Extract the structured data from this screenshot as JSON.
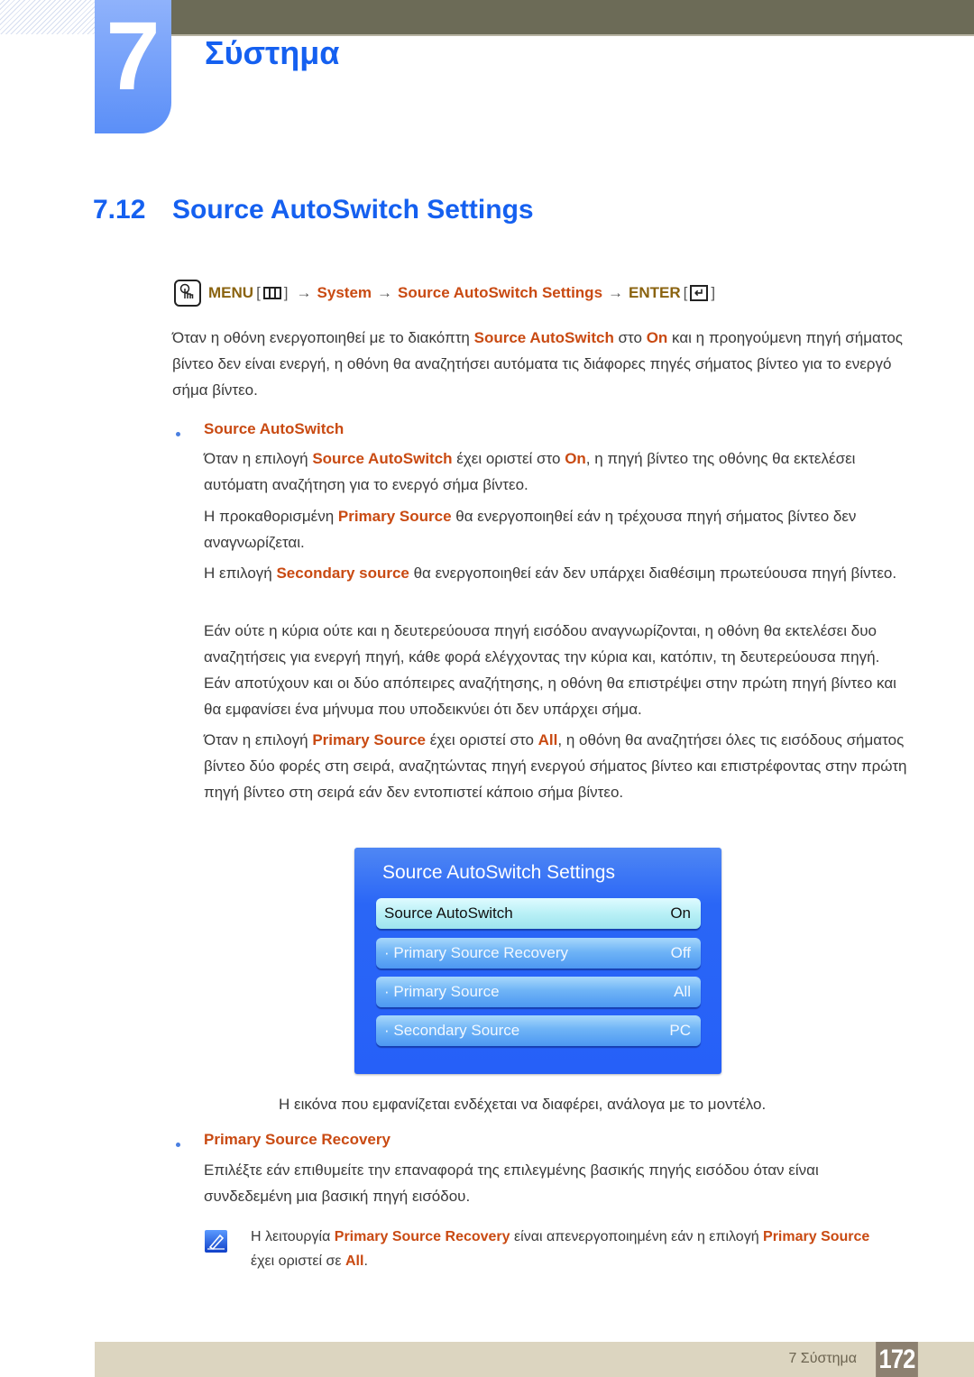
{
  "header": {
    "chapter_number": "7",
    "chapter_title": "Σύστημα"
  },
  "section": {
    "number": "7.12",
    "title": "Source AutoSwitch Settings"
  },
  "menu_path": {
    "icon": "hand-pointer-icon",
    "menu_label": "MENU",
    "menu_icon": "menu-grid-icon",
    "arrow": "→",
    "system_label": "System",
    "page_label": "Source AutoSwitch Settings",
    "enter_label": "ENTER",
    "enter_icon": "enter-return-icon",
    "open_bracket": "[",
    "close_bracket": "]"
  },
  "intro": {
    "p1": "Όταν η οθόνη ενεργοποιηθεί με το διακόπτη ",
    "k1": "Source AutoSwitch",
    "p2": " στο ",
    "k2": "On",
    "p3": " και η προηγούμενη πηγή σήματος βίντεο δεν είναι ενεργή, η οθόνη θα αναζητήσει αυτόματα τις διάφορες πηγές σήματος βίντεο για το ενεργό σήμα βίντεο."
  },
  "bullets": [
    {
      "heading": "Source AutoSwitch",
      "paragraphs": {
        "a": {
          "t1": "Όταν η επιλογή ",
          "k1": "Source AutoSwitch",
          "t2": " έχει οριστεί στο ",
          "k2": "On",
          "t3": ", η πηγή βίντεο της οθόνης θα εκτελέσει αυτόματη αναζήτηση για το ενεργό σήμα βίντεο."
        },
        "b": {
          "t1": "Η προκαθορισμένη ",
          "k1": "Primary Source",
          "t2": " θα ενεργοποιηθεί εάν η τρέχουσα πηγή σήματος βίντεο δεν αναγνωρίζεται."
        },
        "c": {
          "t1": "Η επιλογή ",
          "k1": "Secondary source",
          "t2": " θα ενεργοποιηθεί εάν δεν υπάρχει διαθέσιμη πρωτεύουσα πηγή βίντεο."
        },
        "d": {
          "t1": "Εάν ούτε η κύρια ούτε και η δευτερεύουσα πηγή εισόδου αναγνωρίζονται, η οθόνη θα εκτελέσει δυο αναζητήσεις για ενεργή πηγή, κάθε φορά ελέγχοντας την κύρια και, κατόπιν, τη δευτερεύουσα πηγή. Εάν αποτύχουν και οι δύο απόπειρες αναζήτησης, η οθόνη θα επιστρέψει στην πρώτη πηγή βίντεο και θα εμφανίσει ένα μήνυμα που υποδεικνύει ότι δεν υπάρχει σήμα."
        },
        "e": {
          "t1": "Όταν η επιλογή ",
          "k1": "Primary Source",
          "t2": " έχει οριστεί στο ",
          "k2": "All",
          "t3": ", η οθόνη θα αναζητήσει όλες τις εισόδους σήματος βίντεο δύο φορές στη σειρά, αναζητώντας πηγή ενεργού σήματος βίντεο και επιστρέφοντας στην πρώτη πηγή βίντεο στη σειρά εάν δεν εντοπιστεί κάποιο σήμα βίντεο."
        }
      }
    },
    {
      "heading": "Primary Source Recovery",
      "paragraphs": {
        "a": {
          "t1": "Επιλέξτε εάν επιθυμείτε την επαναφορά της επιλεγμένης βασικής πηγής εισόδου όταν είναι συνδεδεμένη μια βασική πηγή εισόδου."
        }
      }
    }
  ],
  "osd": {
    "title": "Source AutoSwitch Settings",
    "rows": [
      {
        "label": "Source AutoSwitch",
        "value": "On",
        "selected": true
      },
      {
        "label": "· Primary Source Recovery",
        "value": "Off",
        "selected": false
      },
      {
        "label": "· Primary Source",
        "value": "All",
        "selected": false
      },
      {
        "label": "· Secondary Source",
        "value": "PC",
        "selected": false
      }
    ]
  },
  "caption": "Η εικόνα που εμφανίζεται ενδέχεται να διαφέρει, ανάλογα με το μοντέλο.",
  "note": {
    "icon": "note-pencil-icon",
    "t1": "Η λειτουργία ",
    "k1": "Primary Source Recovery",
    "t2": " είναι απενεργοποιημένη εάν η επιλογή ",
    "k2": "Primary Source",
    "t3": " έχει οριστεί σε ",
    "k3": "All",
    "t4": "."
  },
  "footer": {
    "chapter_label": "7 Σύστημα",
    "page_number": "172"
  },
  "colors": {
    "title_blue": "#1560f0",
    "keyword_orange": "#c94a12",
    "menu_gold": "#8a6310",
    "top_bar": "#6c6b57",
    "footer_bar": "#dcd5c0",
    "osd_blue": "#2660f8"
  }
}
